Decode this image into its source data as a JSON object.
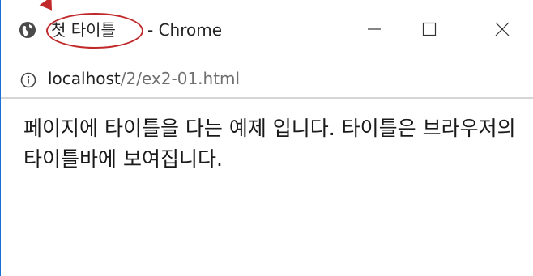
{
  "window": {
    "title": "첫 타이틀",
    "title_suffix": "- Chrome"
  },
  "icons": {
    "globe": "globe-icon",
    "info": "info-icon",
    "minimize": "minimize-icon",
    "maximize": "maximize-icon",
    "close": "close-icon"
  },
  "address_bar": {
    "host": "localhost",
    "path": "/2/ex2-01.html"
  },
  "page": {
    "body_text": "페이지에 타이틀을 다는 예제 입니다. 타이틀은 브라우저의 타이틀바에 보여집니다."
  },
  "colors": {
    "highlight": "#c0282a",
    "window_border": "#1a6fd4"
  }
}
